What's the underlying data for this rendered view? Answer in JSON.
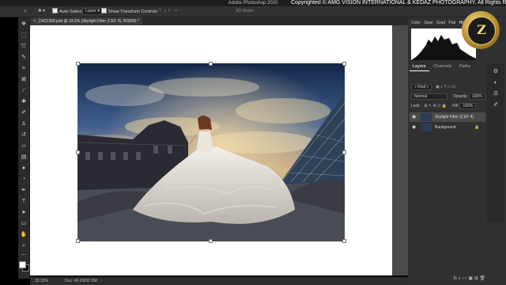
{
  "app": {
    "title": "Adobe Photoshop 2020"
  },
  "watermark": {
    "copyright": "Copyrighted © AMG VISION INTERNATIONAL & KEDAZ PHOTOGRAPHY. All Rights Reserved."
  },
  "options_bar": {
    "auto_select_label": "Auto-Select:",
    "auto_select_value": "Layer",
    "show_transform_label": "Show Transform Controls",
    "mode_3d_label": "3D Mode:"
  },
  "document": {
    "tab_title": "_D4Z2358.psd @ 33.3% (Skylight Filter (CEF 4), RGB/8) *"
  },
  "status_bar": {
    "zoom": "33.33%",
    "doc_size": "Doc: 49.2M/97.8M"
  },
  "panels": {
    "histogram_tabs": [
      "Color",
      "Swat",
      "Grad",
      "Patt",
      "Histo"
    ],
    "tabs": [
      "Layers",
      "Channels",
      "Paths"
    ],
    "active_tab": "Layers",
    "filter_kind": "Kind",
    "blend_mode": "Normal",
    "opacity_label": "Opacity:",
    "opacity_value": "100%",
    "lock_label": "Lock:",
    "fill_label": "Fill:",
    "fill_value": "100%",
    "layers": [
      {
        "name": "Skylight Filter (CEF 4)",
        "selected": true
      },
      {
        "name": "Background",
        "selected": false
      }
    ],
    "bottom_icons": "fx ◐ ▭ ▣ ⊞ 🗑"
  },
  "logo": {
    "letter": "Z"
  },
  "colors": {
    "titlebar": "#1e1e1e",
    "panel": "#303030",
    "canvas_bg": "#4a4a4a",
    "logo_gold": "#d4ae4e"
  }
}
